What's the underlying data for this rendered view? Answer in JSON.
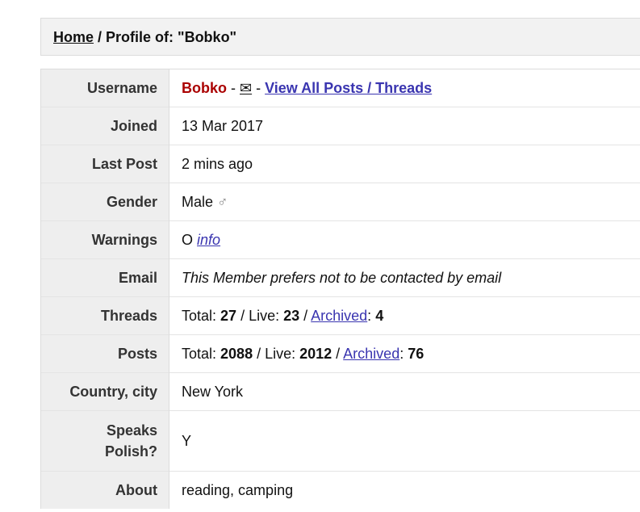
{
  "breadcrumb": {
    "home": "Home",
    "separator": " / ",
    "current": "Profile of: \"Bobko\""
  },
  "profile": {
    "username": {
      "label": "Username",
      "name": "Bobko",
      "sep1": " - ",
      "mail_glyph": "✉",
      "sep2": " - ",
      "all_posts_link": "View All Posts / Threads"
    },
    "joined": {
      "label": "Joined",
      "value": "13 Mar 2017"
    },
    "last_post": {
      "label": "Last Post",
      "value": "2 mins ago"
    },
    "gender": {
      "label": "Gender",
      "value": "Male",
      "icon_glyph": "♂"
    },
    "warnings": {
      "label": "Warnings",
      "value": "O",
      "info_link": "info"
    },
    "email": {
      "label": "Email",
      "value": "This Member prefers not to be contacted by email"
    },
    "threads": {
      "label": "Threads",
      "total_label": "Total: ",
      "total": "27",
      "live_label": " / Live: ",
      "live": "23",
      "slash": " / ",
      "archived_link": "Archived",
      "colon": ": ",
      "archived": "4"
    },
    "posts": {
      "label": "Posts",
      "total_label": "Total: ",
      "total": "2088",
      "live_label": " / Live: ",
      "live": "2012",
      "slash": " / ",
      "archived_link": "Archived",
      "colon": ": ",
      "archived": "76"
    },
    "country": {
      "label": "Country, city",
      "value": "New York"
    },
    "speaks_polish": {
      "label_line1": "Speaks",
      "label_line2": "Polish?",
      "value": "Y"
    },
    "about": {
      "label": "About",
      "value": "reading, camping"
    }
  },
  "colors": {
    "username": "#aa0000",
    "link": "#3a35b0",
    "label_bg": "#eeeeee",
    "breadcrumb_bg": "#f2f2f2"
  }
}
